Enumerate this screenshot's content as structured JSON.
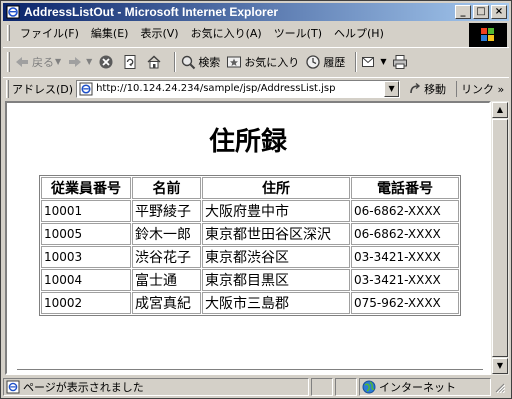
{
  "window": {
    "title": "AddressListOut - Microsoft Internet Explorer",
    "controls": {
      "minimize": "_",
      "maximize": "□",
      "close": "×"
    }
  },
  "menu": [
    "ファイル(F)",
    "編集(E)",
    "表示(V)",
    "お気に入り(A)",
    "ツール(T)",
    "ヘルプ(H)"
  ],
  "toolbar": {
    "back": "戻る",
    "search": "検索",
    "favorites": "お気に入り",
    "history": "履歴"
  },
  "address": {
    "label": "アドレス(D)",
    "url": "http://10.124.24.234/sample/jsp/AddressList.jsp",
    "go": "移動",
    "links": "リンク »"
  },
  "page": {
    "title": "住所録",
    "table": {
      "headers": [
        "従業員番号",
        "名前",
        "住所",
        "電話番号"
      ],
      "rows": [
        [
          "10001",
          "平野綾子",
          "大阪府豊中市",
          "06-6862-XXXX"
        ],
        [
          "10005",
          "鈴木一郎",
          "東京都世田谷区深沢",
          "06-6862-XXXX"
        ],
        [
          "10003",
          "渋谷花子",
          "東京都渋谷区",
          "03-3421-XXXX"
        ],
        [
          "10004",
          "富士通",
          "東京都目黒区",
          "03-3421-XXXX"
        ],
        [
          "10002",
          "成宮真紀",
          "大阪市三島郡",
          "075-962-XXXX"
        ]
      ]
    }
  },
  "status": {
    "message": "ページが表示されました",
    "zone": "インターネット"
  },
  "colors": {
    "titlebar_start": "#0a246a",
    "titlebar_end": "#a6caf0",
    "chrome": "#d4d0c8"
  },
  "icons": {
    "back": "back-arrow-icon",
    "forward": "forward-arrow-icon",
    "stop": "stop-icon",
    "refresh": "refresh-icon",
    "home": "home-icon",
    "search": "search-icon",
    "favorites": "favorites-icon",
    "history": "history-icon",
    "mail": "mail-icon",
    "print": "print-icon"
  }
}
